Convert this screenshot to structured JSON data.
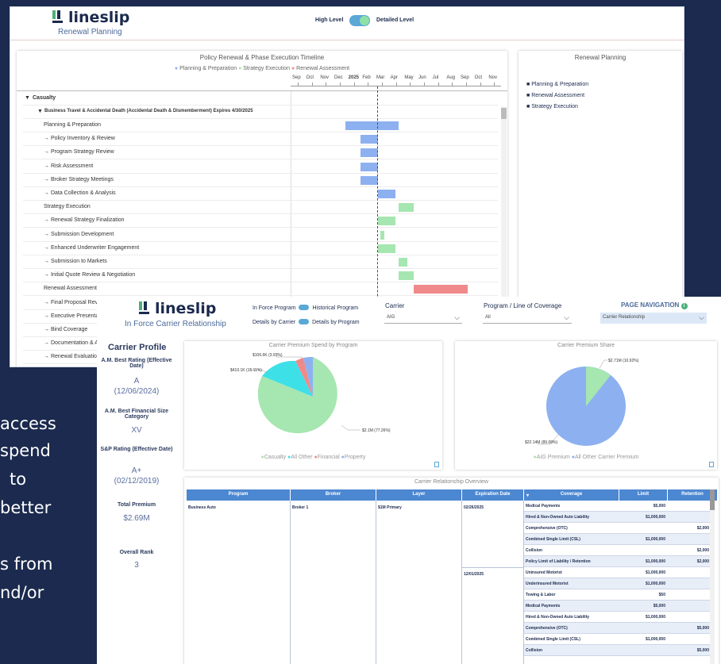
{
  "background_text": [
    "access",
    "spend",
    "to",
    "better",
    "",
    "s from",
    "nd/or"
  ],
  "colors": {
    "navy": "#1b2a4e",
    "planning": "#8db1f0",
    "strategy": "#a6e6b0",
    "renewal": "#f08a8a",
    "toggle": "#5aa8d6",
    "table_header": "#4c87d1"
  },
  "window1": {
    "brand": "lineslip",
    "subtitle": "Renewal Planning",
    "toggle_left": "High Level",
    "toggle_right": "Detailed Level",
    "timeline": {
      "title": "Policy Renewal & Phase Execution Timeline",
      "legend": [
        "Planning & Preparation",
        "Strategy Execution",
        "Renewal Assessment"
      ],
      "months_pre": [
        "Sep",
        "Oct",
        "Nov",
        "Dec"
      ],
      "year": "2025",
      "months_post": [
        "Feb",
        "Mar",
        "Apr",
        "May",
        "Jun",
        "Jul",
        "Aug",
        "Sep",
        "Oct",
        "Nov"
      ],
      "group": "Casualty",
      "policy": "Business Travel & Accidental Death (Accidental Death & Dismemberment) Expires 4/30/2025",
      "rows": [
        {
          "label": "Planning & Preparation",
          "phase": "planning",
          "start": 3.9,
          "end": 7.7
        },
        {
          "label": "→ Policy Inventory & Review",
          "phase": "planning",
          "start": 5.0,
          "end": 6.2
        },
        {
          "label": "→ Program Strategy Review",
          "phase": "planning",
          "start": 5.0,
          "end": 6.2
        },
        {
          "label": "→ Risk Assessment",
          "phase": "planning",
          "start": 5.0,
          "end": 6.2
        },
        {
          "label": "→ Broker Strategy Meetings",
          "phase": "planning",
          "start": 5.0,
          "end": 6.2
        },
        {
          "label": "→ Data Collection & Analysis",
          "phase": "planning",
          "start": 6.2,
          "end": 7.5
        },
        {
          "label": "Strategy Execution",
          "phase": "strategy",
          "start": 7.7,
          "end": 8.8
        },
        {
          "label": "→ Renewal Strategy Finalization",
          "phase": "strategy",
          "start": 6.2,
          "end": 7.5
        },
        {
          "label": "→ Submission Development",
          "phase": "strategy",
          "start": 6.4,
          "end": 6.7
        },
        {
          "label": "→ Enhanced Underwriter Engagement",
          "phase": "strategy",
          "start": 6.2,
          "end": 7.5
        },
        {
          "label": "→ Submission to Markets",
          "phase": "strategy",
          "start": 7.7,
          "end": 8.3
        },
        {
          "label": "→ Initial Quote Review & Negotiation",
          "phase": "strategy",
          "start": 7.7,
          "end": 8.8
        },
        {
          "label": "Renewal Assessment",
          "phase": "renewal",
          "start": 8.8,
          "end": 12.6
        },
        {
          "label": "→ Final Proposal Review",
          "phase": "renewal",
          "start": null,
          "end": null
        },
        {
          "label": "→ Executive Presentation",
          "phase": "renewal",
          "start": null,
          "end": null
        },
        {
          "label": "→ Bind Coverage",
          "phase": "renewal",
          "start": null,
          "end": null
        },
        {
          "label": "→ Documentation & Administration",
          "phase": "renewal",
          "start": null,
          "end": null
        },
        {
          "label": "→ Renewal Evaluation",
          "phase": "renewal",
          "start": null,
          "end": null
        }
      ],
      "today_position_month": 7.95
    },
    "right_panel": {
      "title": "Renewal Planning",
      "items": [
        "Planning & Preparation",
        "Renewal Assessment",
        "Strategy Execution"
      ]
    }
  },
  "window2": {
    "brand": "lineslip",
    "subtitle": "In Force Carrier Relationship",
    "toggles": [
      {
        "left": "In Force Program",
        "right": "Historical Program"
      },
      {
        "left": "Details by Carrier",
        "right": "Details by Program"
      }
    ],
    "carrier": {
      "label": "Carrier",
      "value": "AIG"
    },
    "program": {
      "label": "Program / Line of Coverage",
      "value": "All"
    },
    "nav": {
      "label": "PAGE NAVIGATION",
      "value": "Carrier Relationship"
    },
    "profile": {
      "title": "Carrier Profile",
      "am_rating_label": "A.M. Best Rating (Effective Date)",
      "am_rating": "A",
      "am_rating_date": "(12/06/2024)",
      "am_fin_label": "A.M. Best Financial Size Category",
      "am_fin": "XV",
      "sp_label": "S&P Rating (Effective Date)",
      "sp_rating": "A+",
      "sp_date": "(02/12/2019)",
      "total_label": "Total Premium",
      "total": "$2.69M",
      "rank_label": "Overall Rank",
      "rank": "3"
    },
    "pie1": {
      "title": "Carrier Premium Spend by Program",
      "labels": [
        "$106.6K (3.93%)",
        "$410.1K (15.11%)",
        "$2.1M (77.26%)"
      ],
      "legend": [
        "Casualty",
        "All Other",
        "Financial",
        "Property"
      ]
    },
    "pie2": {
      "title": "Carrier Premium Share",
      "labels": [
        "$2.71M (10.92%)",
        "$22.14M (89.08%)"
      ],
      "legend": [
        "AIG Premium",
        "All Other Carrier Premium"
      ]
    },
    "table": {
      "title": "Carrier Relationship Overview",
      "headers": [
        "Program",
        "Broker",
        "Layer",
        "Expiration Date",
        "Coverage",
        "Limit",
        "Retention"
      ],
      "program": "Business Auto",
      "broker": "Broker 1",
      "layer": "$1M Primary",
      "exp1": "02/26/2025",
      "exp2": "12/01/2025",
      "rows": [
        {
          "coverage": "Medical Payments",
          "limit": "$5,000",
          "retention": ""
        },
        {
          "coverage": "Hired & Non-Owned Auto Liability",
          "limit": "$1,000,000",
          "retention": ""
        },
        {
          "coverage": "Comprehensive (OTC)",
          "limit": "",
          "retention": "$2,000"
        },
        {
          "coverage": "Combined Single Limit (CSL)",
          "limit": "$1,000,000",
          "retention": ""
        },
        {
          "coverage": "Collision",
          "limit": "",
          "retention": "$2,000"
        },
        {
          "coverage": "Policy Limit of Liability / Retention",
          "limit": "$1,000,000",
          "retention": "$2,000"
        },
        {
          "coverage": "Uninsured Motorist",
          "limit": "$1,000,000",
          "retention": ""
        },
        {
          "coverage": "Underinsured Motorist",
          "limit": "$1,000,000",
          "retention": ""
        },
        {
          "coverage": "Towing & Labor",
          "limit": "$50",
          "retention": ""
        },
        {
          "coverage": "Medical Payments",
          "limit": "$5,000",
          "retention": ""
        },
        {
          "coverage": "Hired & Non-Owned Auto Liability",
          "limit": "$1,000,000",
          "retention": ""
        },
        {
          "coverage": "Comprehensive (OTC)",
          "limit": "",
          "retention": "$5,000"
        },
        {
          "coverage": "Combined Single Limit (CSL)",
          "limit": "$1,000,000",
          "retention": ""
        },
        {
          "coverage": "Collision",
          "limit": "",
          "retention": "$5,000"
        }
      ]
    }
  }
}
